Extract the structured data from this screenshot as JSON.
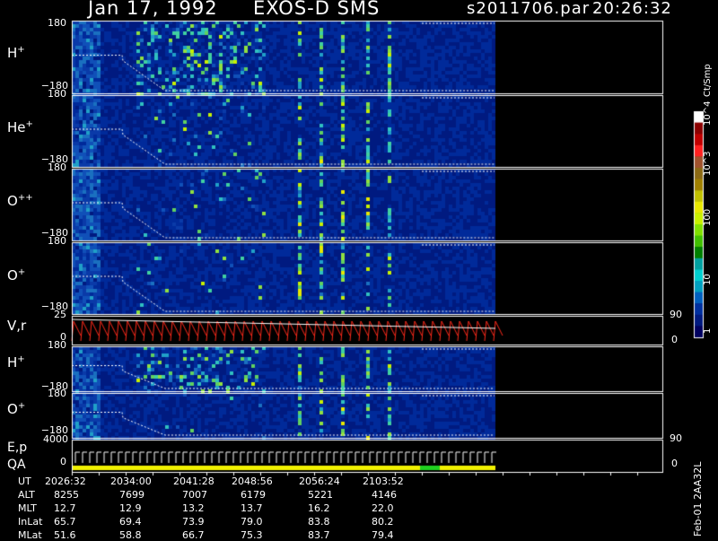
{
  "header": {
    "date": "Jan 17, 1992",
    "instrument": "EXOS-D SMS",
    "file": "s2011706.par",
    "time": "20:26:32"
  },
  "colors": {
    "bg": "#000000",
    "panel": "#0a2a8c",
    "trace": "#ffffff",
    "vr_trace": "#ff2a1a",
    "qa_yellow": "#f0f000",
    "qa_green": "#20d020"
  },
  "chart_data": {
    "type": "heatmap",
    "panels": [
      {
        "id": "h_plus_1",
        "label_base": "H",
        "label_sup": "+",
        "ymax": "180",
        "ymin": "−180",
        "right_label": ""
      },
      {
        "id": "he_plus",
        "label_base": "He",
        "label_sup": "+",
        "ymax": "180",
        "ymin": "−180",
        "right_label": ""
      },
      {
        "id": "o_pp",
        "label_base": "O",
        "label_sup": "++",
        "ymax": "180",
        "ymin": "−180",
        "right_label": ""
      },
      {
        "id": "o_plus_1",
        "label_base": "O",
        "label_sup": "+",
        "ymax": "180",
        "ymin": "−180",
        "right_label": ""
      },
      {
        "id": "vr",
        "label_base": "V,r",
        "label_sup": "",
        "ymax": "25",
        "ymin": "0",
        "right_top": "90",
        "right_bottom": "0"
      },
      {
        "id": "h_plus_2",
        "label_base": "H",
        "label_sup": "+",
        "ymax": "180",
        "ymin": "−180",
        "right_label": ""
      },
      {
        "id": "o_plus_2",
        "label_base": "O",
        "label_sup": "+",
        "ymax": "180",
        "ymin": "−180",
        "right_top": "90"
      },
      {
        "id": "ep",
        "label_base": "E,p",
        "label_line2": "QA",
        "ymax": "4000",
        "ymin": "0",
        "right_bottom": "0"
      }
    ],
    "colorbar": {
      "title": "Ct/Smp",
      "ticks": [
        "10^4",
        "10^3",
        "100",
        "10",
        "1"
      ],
      "colors": [
        "#ffffff",
        "#8b0000",
        "#c00000",
        "#ff2020",
        "#a0522d",
        "#8b6914",
        "#a08000",
        "#c0c000",
        "#e8e800",
        "#c8f000",
        "#80e000",
        "#40c000",
        "#008000",
        "#00a0a0",
        "#00d0d0",
        "#00a0c0",
        "#0060c0",
        "#0030a0",
        "#001a80",
        "#000060"
      ]
    },
    "ephemeris": {
      "rows": [
        "UT",
        "ALT",
        "MLT",
        "InLat",
        "MLat"
      ],
      "columns": [
        {
          "UT": "2026:32",
          "ALT": "8255",
          "MLT": "12.7",
          "InLat": "65.7",
          "MLat": "51.6"
        },
        {
          "UT": "2034:00",
          "ALT": "7699",
          "MLT": "12.9",
          "InLat": "69.4",
          "MLat": "58.8"
        },
        {
          "UT": "2041:28",
          "ALT": "7007",
          "MLT": "13.2",
          "InLat": "73.9",
          "MLat": "66.7"
        },
        {
          "UT": "2048:56",
          "ALT": "6179",
          "MLT": "13.7",
          "InLat": "79.0",
          "MLat": "75.3"
        },
        {
          "UT": "2056:24",
          "ALT": "5221",
          "MLT": "16.2",
          "InLat": "83.8",
          "MLat": "83.7"
        },
        {
          "UT": "2103:52",
          "ALT": "4146",
          "MLT": "22.0",
          "InLat": "80.2",
          "MLat": "79.4"
        }
      ]
    }
  },
  "footer": {
    "version": "Feb-01 2AA32L"
  }
}
